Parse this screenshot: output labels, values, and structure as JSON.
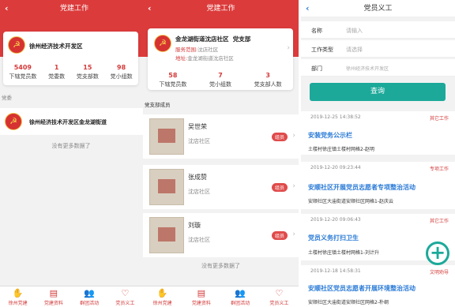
{
  "colors": {
    "primary": "#dc3b3b",
    "teal": "#1ca99a",
    "link": "#2a7ad6"
  },
  "screen1": {
    "title": "党建工作",
    "org_name": "徐州经济技术开发区",
    "stats": [
      {
        "value": "5409",
        "label": "下辖党员数"
      },
      {
        "value": "1",
        "label": "党委数"
      },
      {
        "value": "15",
        "label": "党支部数"
      },
      {
        "value": "98",
        "label": "党小组数"
      }
    ],
    "section": "党委",
    "sub_org": "徐州经济技术开发区金龙湖街道",
    "no_more": "没有更多数据了"
  },
  "screen2": {
    "title": "党建工作",
    "org_name": "金龙湖街道沈店社区",
    "org_type": "党支部",
    "scope_label": "服务范围:",
    "scope_value": "沈店社区",
    "addr_label": "地址:",
    "addr_value": "金龙湖街道沈店社区",
    "stats": [
      {
        "value": "58",
        "label": "下辖党员数"
      },
      {
        "value": "7",
        "label": "党小组数"
      },
      {
        "value": "3",
        "label": "党支部人数"
      }
    ],
    "section": "党支部成员",
    "members": [
      {
        "name": "吴世荣",
        "org": "沈店社区",
        "badge": "组员"
      },
      {
        "name": "张成赞",
        "org": "沈店社区",
        "badge": "组员"
      },
      {
        "name": "刘璇",
        "org": "沈店社区",
        "badge": "组员"
      }
    ],
    "no_more": "没有更多数据了"
  },
  "tabs": [
    {
      "icon": "hand-icon",
      "glyph": "✋",
      "label": "徐州党建"
    },
    {
      "icon": "document-icon",
      "glyph": "▤",
      "label": "党建资料"
    },
    {
      "icon": "group-icon",
      "glyph": "👥",
      "label": "群团活动"
    },
    {
      "icon": "heart-icon",
      "glyph": "♡",
      "label": "党员义工"
    }
  ],
  "screen3": {
    "title": "党员义工",
    "form": [
      {
        "label": "名称",
        "placeholder": "请输入"
      },
      {
        "label": "工作类型",
        "placeholder": "请选择"
      },
      {
        "label": "部门",
        "placeholder": "徐州经济技术开发区"
      }
    ],
    "query_label": "查询",
    "items": [
      {
        "date": "2019-12-25 14:38:52",
        "type": "其它工作",
        "title": "安装党务公示栏",
        "address": "土楼村徐庄镇土楼村网格2-赵明"
      },
      {
        "date": "2019-12-20 09:23:44",
        "type": "专项工作",
        "title": "安顺社区开展党员志愿者专项整治活动",
        "address": "安顺社区大庙街道安顺社区网格1-赵庆云"
      },
      {
        "date": "2019-12-20 09:06:43",
        "type": "其它工作",
        "title": "党员义务打扫卫生",
        "address": "土楼村徐庄镇土楼村网格1-刘计升"
      },
      {
        "date": "2019-12-18 14:58:31",
        "type": "文明劝导",
        "title": "安顺社区党员志愿者开展环境整治活动",
        "address": "安顺社区大庙街道安顺社区网格2-朴纲"
      }
    ],
    "fab_label": "+"
  }
}
